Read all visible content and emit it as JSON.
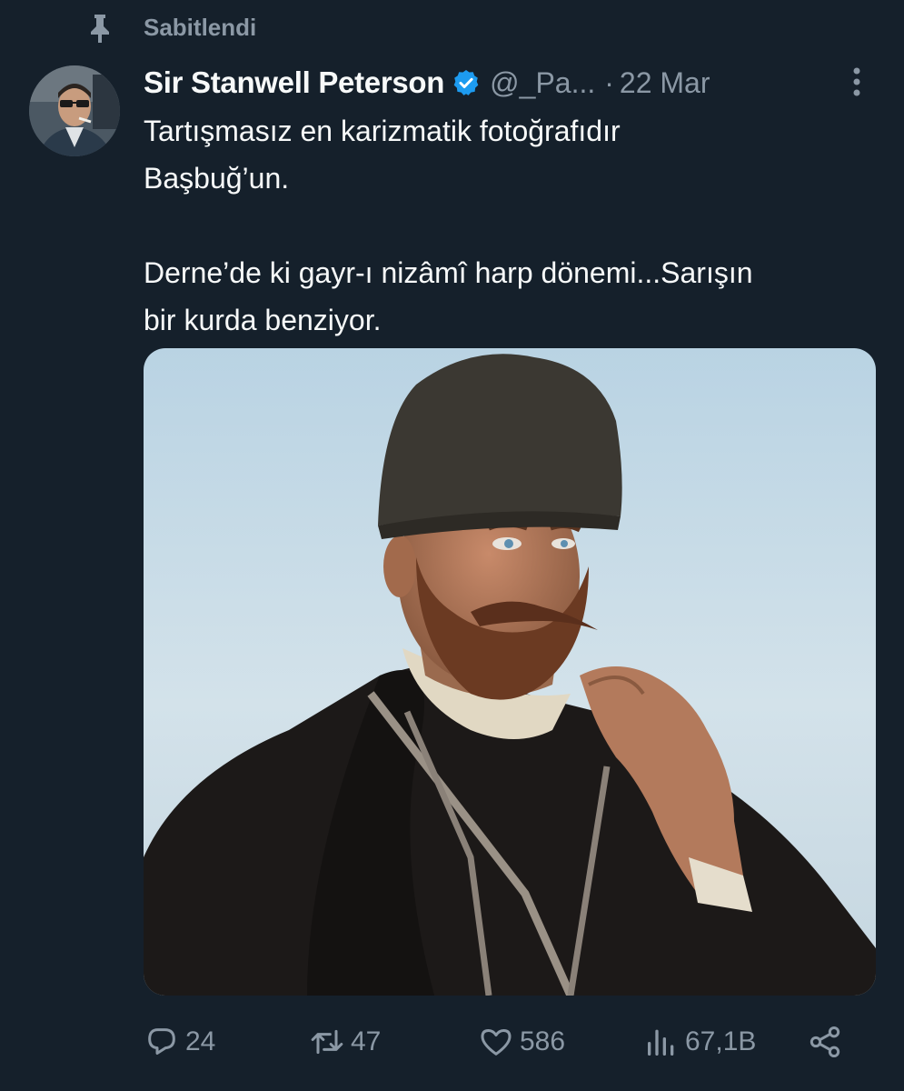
{
  "pinned": {
    "label": "Sabitlendi"
  },
  "tweet": {
    "author_name": "Sir Stanwell Peterson",
    "handle": "@_Pa...",
    "separator": "·",
    "date": "22 Mar",
    "text_lines": [
      "Tartışmasız en karizmatik fotoğrafıdır",
      "Başbuğ’un.",
      "Derne’de ki gayr-ı nizâmî harp dönemi...Sarışın",
      "bir kurda benziyor."
    ],
    "media": {
      "description": ""
    }
  },
  "actions": {
    "replies": "24",
    "retweets": "47",
    "likes": "586",
    "views": "67,1B"
  },
  "colors": {
    "background": "#15202b",
    "primary_text": "#f7f9f9",
    "secondary_text": "#8b98a5",
    "verified": "#1d9bf0"
  },
  "icons": [
    "pin-icon",
    "verified-badge-icon",
    "more-options-icon",
    "reply-icon",
    "retweet-icon",
    "like-icon",
    "views-icon",
    "share-icon"
  ]
}
